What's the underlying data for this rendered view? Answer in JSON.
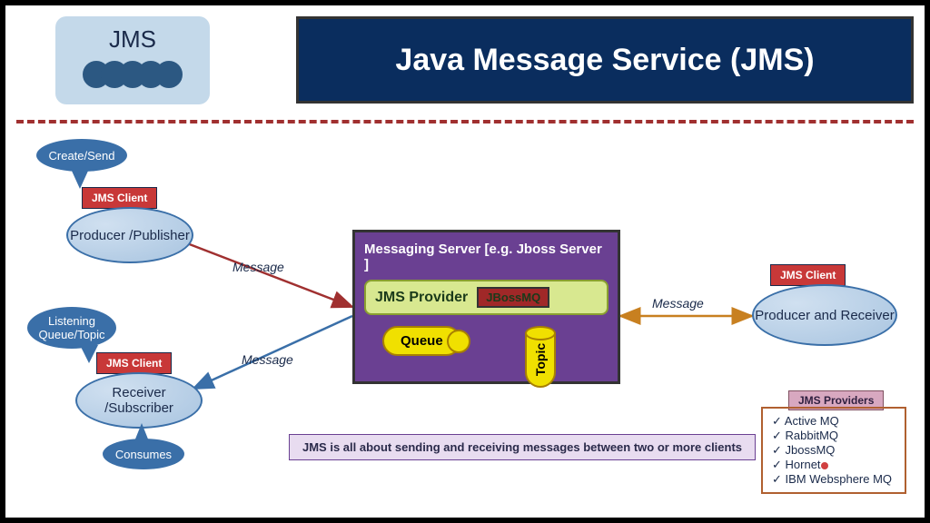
{
  "logo": {
    "text": "JMS"
  },
  "title": "Java Message Service (JMS)",
  "producer": {
    "callout": "Create/Send",
    "tag": "JMS Client",
    "label": "Producer /Publisher",
    "arrow": "Message"
  },
  "receiver": {
    "callout": "Listening Queue/Topic",
    "tag": "JMS Client",
    "label": "Receiver /Subscriber",
    "consumes": "Consumes",
    "arrow": "Message"
  },
  "server": {
    "title": "Messaging Server  [e.g. Jboss Server ]",
    "provider": "JMS Provider",
    "jbossmq": "JBossMQ",
    "queue": "Queue",
    "topic": "Topic"
  },
  "right": {
    "tag": "JMS Client",
    "label": "Producer and Receiver",
    "arrow": "Message"
  },
  "footer": "JMS is all about sending and receiving messages between two or more clients",
  "providers": {
    "header": "JMS Providers",
    "items": [
      "Active MQ",
      "RabbitMQ",
      "JbossMQ",
      "Hornet",
      "IBM Websphere MQ"
    ]
  }
}
